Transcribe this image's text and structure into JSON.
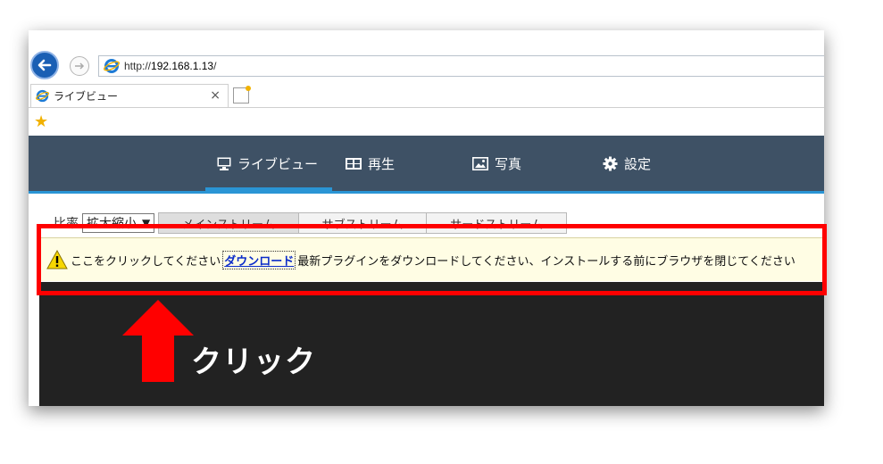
{
  "browser": {
    "url_scheme": "http://",
    "url_host": "192.168.1.13",
    "url_path": "/",
    "tab_title": "ライブビュー",
    "tab_close": "×"
  },
  "nav": {
    "items": [
      {
        "label": "ライブビュー",
        "icon": "monitor-icon"
      },
      {
        "label": "再生",
        "icon": "film-icon"
      },
      {
        "label": "写真",
        "icon": "photo-icon"
      },
      {
        "label": "設定",
        "icon": "gear-icon"
      }
    ]
  },
  "toolbar": {
    "ratio_label": "比率",
    "ratio_value": "拡大縮小",
    "streams": [
      "メインストリーム",
      "サブストリーム",
      "サードストリーム"
    ]
  },
  "plugin_bar": {
    "prefix": "ここをクリックしてください",
    "link": "ダウンロード",
    "suffix": "最新プラグインをダウンロードしてください、インストールする前にブラウザを閉じてください"
  },
  "annotation": {
    "label": "クリック",
    "frame_color": "#ff0000",
    "arrow_color": "#ff0000"
  }
}
